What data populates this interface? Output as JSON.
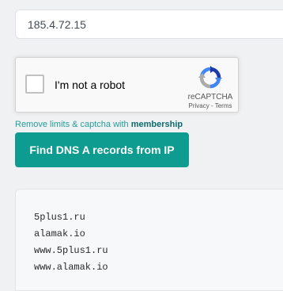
{
  "ip_input": {
    "value": "185.4.72.15"
  },
  "recaptcha": {
    "label": "I'm not a robot",
    "brand": "reCAPTCHA",
    "privacy_link": "Privacy",
    "separator": " - ",
    "terms_link": "Terms",
    "checked": false
  },
  "limits": {
    "text": "Remove limits & captcha with ",
    "link": "membership"
  },
  "find_button": {
    "label": "Find DNS A records from IP"
  },
  "results": [
    "5plus1.ru",
    "alamak.io",
    "www.5plus1.ru",
    "www.alamak.io"
  ],
  "colors": {
    "accent": "#0e9b90",
    "link": "#239d99",
    "link_bold": "#0d6b6e"
  }
}
